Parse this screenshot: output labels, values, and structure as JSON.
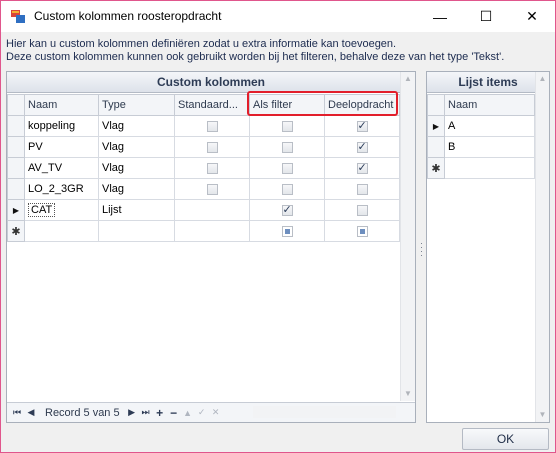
{
  "window": {
    "title": "Custom kolommen roosteropdracht",
    "minimize_glyph": "—",
    "maximize_glyph": "☐",
    "close_glyph": "✕"
  },
  "description": {
    "line1": "Hier kan u custom kolommen definiëren zodat u extra informatie kan toevoegen.",
    "line2": "Deze custom kolommen kunnen ook gebruikt worden bij het filteren, behalve deze van het type 'Tekst'."
  },
  "custom_panel": {
    "title": "Custom kolommen",
    "columns": [
      "Naam",
      "Type",
      "Standaard...",
      "Als filter",
      "Deelopdracht"
    ],
    "rows": [
      {
        "naam": "koppeling",
        "type": "Vlag",
        "standaard": false,
        "als_filter": false,
        "deelopdracht": true
      },
      {
        "naam": "PV",
        "type": "Vlag",
        "standaard": false,
        "als_filter": false,
        "deelopdracht": true
      },
      {
        "naam": "AV_TV",
        "type": "Vlag",
        "standaard": false,
        "als_filter": false,
        "deelopdracht": true
      },
      {
        "naam": "LO_2_3GR",
        "type": "Vlag",
        "standaard": false,
        "als_filter": false,
        "deelopdracht": false
      },
      {
        "naam": "CAT",
        "type": "Lijst",
        "standaard": null,
        "als_filter": true,
        "deelopdracht": false
      }
    ],
    "navigator": {
      "record_text": "Record 5 van 5"
    }
  },
  "list_panel": {
    "title": "Lijst items",
    "columns": [
      "Naam"
    ],
    "rows": [
      "A",
      "B"
    ]
  },
  "buttons": {
    "ok": "OK"
  },
  "colors": {
    "highlight_outline": "#e21e2b",
    "window_border": "#e0568c"
  }
}
